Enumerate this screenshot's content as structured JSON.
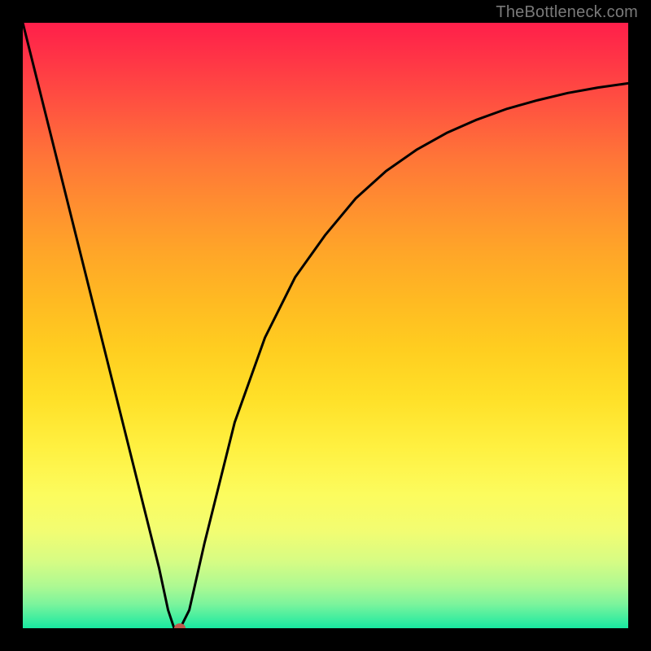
{
  "attribution": "TheBottleneck.com",
  "colors": {
    "frame": "#000000",
    "curve": "#000000",
    "marker": "#c0594e",
    "attribution_text": "#7a7a7a"
  },
  "chart_data": {
    "type": "line",
    "title": "",
    "xlabel": "",
    "ylabel": "",
    "xlim": [
      0,
      100
    ],
    "ylim": [
      0,
      100
    ],
    "series": [
      {
        "name": "bottleneck-curve",
        "x": [
          0,
          5,
          10,
          15,
          20,
          22.5,
          24,
          25,
          26,
          27.5,
          30,
          35,
          40,
          45,
          50,
          55,
          60,
          65,
          70,
          75,
          80,
          85,
          90,
          95,
          100
        ],
        "y": [
          100,
          80,
          60,
          40,
          20,
          10,
          3,
          0,
          0,
          3,
          14,
          34,
          48,
          58,
          65,
          71,
          75.5,
          79,
          81.8,
          84,
          85.8,
          87.2,
          88.4,
          89.3,
          90
        ]
      }
    ],
    "marker": {
      "x": 26,
      "y": 0
    },
    "gradient_stops": [
      {
        "pos": 0,
        "color": "#ff1f4a"
      },
      {
        "pos": 6,
        "color": "#ff3546"
      },
      {
        "pos": 14,
        "color": "#ff5440"
      },
      {
        "pos": 22,
        "color": "#ff7438"
      },
      {
        "pos": 30,
        "color": "#ff8e30"
      },
      {
        "pos": 38,
        "color": "#ffa628"
      },
      {
        "pos": 46,
        "color": "#ffba22"
      },
      {
        "pos": 54,
        "color": "#ffce20"
      },
      {
        "pos": 62,
        "color": "#ffe028"
      },
      {
        "pos": 70,
        "color": "#fff040"
      },
      {
        "pos": 78,
        "color": "#fcfc5e"
      },
      {
        "pos": 84,
        "color": "#f2fd72"
      },
      {
        "pos": 89,
        "color": "#d6fc84"
      },
      {
        "pos": 93,
        "color": "#aef992"
      },
      {
        "pos": 96,
        "color": "#7cf49c"
      },
      {
        "pos": 99,
        "color": "#31eca0"
      },
      {
        "pos": 100,
        "color": "#18e8a0"
      }
    ]
  }
}
